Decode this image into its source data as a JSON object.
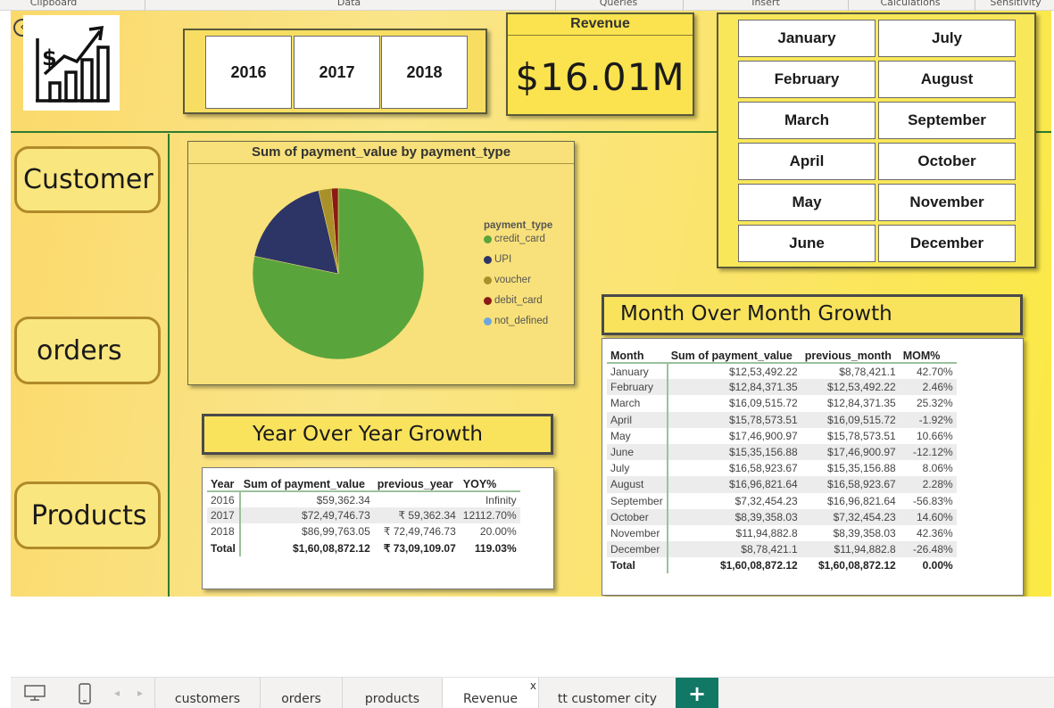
{
  "ribbon": {
    "groups": [
      "Clipboard",
      "Data",
      "Queries",
      "Insert",
      "Calculations",
      "Sensitivity"
    ]
  },
  "years": [
    "2016",
    "2017",
    "2018"
  ],
  "revenue": {
    "title": "Revenue",
    "value": "$16.01M"
  },
  "months": [
    "January",
    "July",
    "February",
    "August",
    "March",
    "September",
    "April",
    "October",
    "May",
    "November",
    "June",
    "December"
  ],
  "nav": {
    "customer": "Customer",
    "orders": "orders",
    "products": "Products"
  },
  "pie_chart": {
    "title": "Sum of payment_value by payment_type",
    "legend_title": "payment_type"
  },
  "chart_data": {
    "type": "pie",
    "title": "Sum of payment_value by payment_type",
    "legend_title": "payment_type",
    "legend_placement": "right",
    "labels": [
      "credit_card",
      "UPI",
      "voucher",
      "debit_card",
      "not_defined"
    ],
    "values": [
      78.3,
      18.0,
      2.4,
      1.3,
      0.0
    ],
    "colors": [
      "#5aa43c",
      "#2d3566",
      "#a8902a",
      "#8c1a16",
      "#6fa6dd"
    ]
  },
  "yoy": {
    "title": "Year Over Year Growth",
    "headers": [
      "Year",
      "Sum of payment_value",
      "previous_year",
      "YOY%"
    ],
    "rows": [
      [
        "2016",
        "$59,362.34",
        "",
        "Infinity"
      ],
      [
        "2017",
        "$72,49,746.73",
        "₹ 59,362.34",
        "12112.70%"
      ],
      [
        "2018",
        "$86,99,763.05",
        "₹ 72,49,746.73",
        "20.00%"
      ]
    ],
    "total": [
      "Total",
      "$1,60,08,872.12",
      "₹ 73,09,109.07",
      "119.03%"
    ]
  },
  "mom": {
    "title": "Month Over Month Growth",
    "headers": [
      "Month",
      "Sum of payment_value",
      "previous_month",
      "MOM%"
    ],
    "rows": [
      [
        "January",
        "$12,53,492.22",
        "$8,78,421.1",
        "42.70%"
      ],
      [
        "February",
        "$12,84,371.35",
        "$12,53,492.22",
        "2.46%"
      ],
      [
        "March",
        "$16,09,515.72",
        "$12,84,371.35",
        "25.32%"
      ],
      [
        "April",
        "$15,78,573.51",
        "$16,09,515.72",
        "-1.92%"
      ],
      [
        "May",
        "$17,46,900.97",
        "$15,78,573.51",
        "10.66%"
      ],
      [
        "June",
        "$15,35,156.88",
        "$17,46,900.97",
        "-12.12%"
      ],
      [
        "July",
        "$16,58,923.67",
        "$15,35,156.88",
        "8.06%"
      ],
      [
        "August",
        "$16,96,821.64",
        "$16,58,923.67",
        "2.28%"
      ],
      [
        "September",
        "$7,32,454.23",
        "$16,96,821.64",
        "-56.83%"
      ],
      [
        "October",
        "$8,39,358.03",
        "$7,32,454.23",
        "14.60%"
      ],
      [
        "November",
        "$11,94,882.8",
        "$8,39,358.03",
        "42.36%"
      ],
      [
        "December",
        "$8,78,421.1",
        "$11,94,882.8",
        "-26.48%"
      ]
    ],
    "total": [
      "Total",
      "$1,60,08,872.12",
      "$1,60,08,872.12",
      "0.00%"
    ]
  },
  "tabs": [
    {
      "label": "customers"
    },
    {
      "label": "orders"
    },
    {
      "label": "products"
    },
    {
      "label": "Revenue",
      "close": "x"
    },
    {
      "label": "tt customer city"
    }
  ],
  "add_tab_label": "+",
  "icons": [
    "back-arrow-icon",
    "revenue-growth-logo-icon",
    "desktop-view-icon",
    "mobile-view-icon",
    "scroll-left-icon",
    "scroll-right-icon",
    "add-page-icon"
  ]
}
